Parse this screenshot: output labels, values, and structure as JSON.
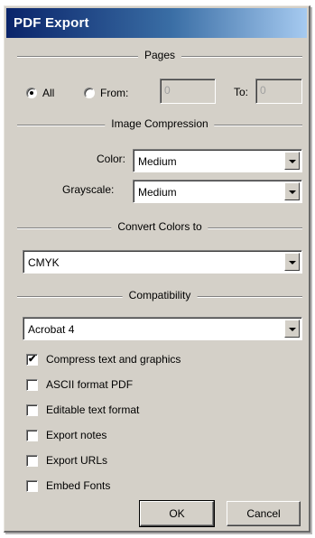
{
  "window": {
    "title": "PDF Export"
  },
  "pages": {
    "group_label": "Pages",
    "all_label": "All",
    "all_selected": true,
    "from_label": "From:",
    "from_selected": false,
    "from_value": "0",
    "to_label": "To:",
    "to_value": "0"
  },
  "image_compression": {
    "group_label": "Image Compression",
    "color_label": "Color:",
    "color_value": "Medium",
    "grayscale_label": "Grayscale:",
    "grayscale_value": "Medium"
  },
  "convert_colors": {
    "group_label": "Convert Colors to",
    "value": "CMYK"
  },
  "compatibility": {
    "group_label": "Compatibility",
    "value": "Acrobat 4"
  },
  "options": [
    {
      "label": "Compress text and graphics",
      "checked": true,
      "mark": "✔"
    },
    {
      "label": "ASCII format PDF",
      "checked": false,
      "mark": ""
    },
    {
      "label": "Editable text format",
      "checked": false,
      "mark": ""
    },
    {
      "label": "Export notes",
      "checked": false,
      "mark": ""
    },
    {
      "label": "Export URLs",
      "checked": false,
      "mark": ""
    },
    {
      "label": "Embed Fonts",
      "checked": false,
      "mark": ""
    }
  ],
  "buttons": {
    "ok": "OK",
    "cancel": "Cancel"
  },
  "colors": {
    "titlebar_start": "#0a246a",
    "titlebar_end": "#a6caf0",
    "face": "#d4d0c8"
  }
}
